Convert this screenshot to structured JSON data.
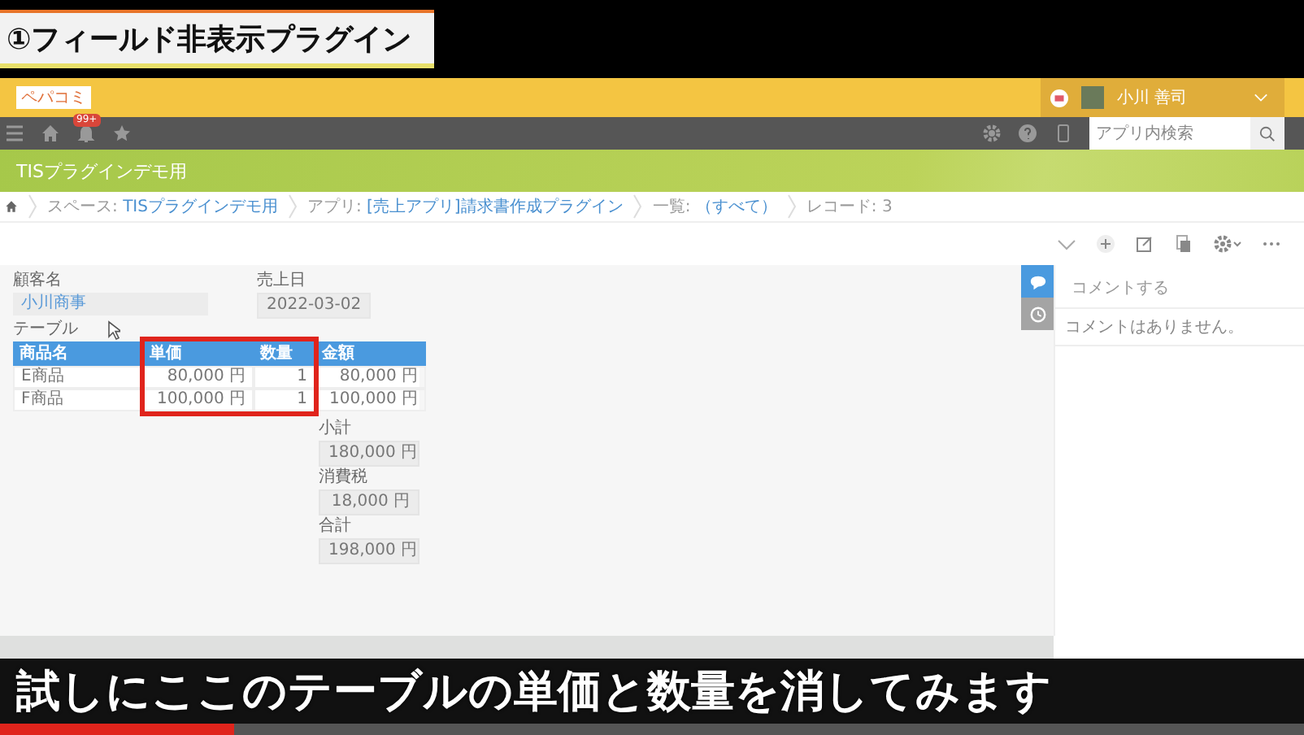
{
  "video_title": "①フィールド非表示プラグイン",
  "header": {
    "logo": "ペパコミ",
    "user_name": "小川 善司"
  },
  "nav": {
    "notification_badge": "99+",
    "search": {
      "placeholder": "アプリ内検索"
    }
  },
  "space_title": "TISプラグインデモ用",
  "breadcrumb": [
    {
      "label": "スペース: ",
      "link": "TISプラグインデモ用"
    },
    {
      "label": "アプリ: ",
      "link": "[売上アプリ]請求書作成プラグイン"
    },
    {
      "label": "一覧: ",
      "link": "（すべて）"
    },
    {
      "label": "レコード: 3"
    }
  ],
  "record": {
    "fields": [
      {
        "label": "顧客名",
        "value": "小川商事",
        "kind": "link"
      },
      {
        "label": "売上日",
        "value": "2022-03-02",
        "kind": "plain"
      }
    ],
    "table_label": "テーブル",
    "table": {
      "columns": [
        "商品名",
        "単価",
        "数量",
        "金額"
      ],
      "rows": [
        [
          "E商品",
          "80,000 円",
          "1",
          "80,000 円"
        ],
        [
          "F商品",
          "100,000 円",
          "1",
          "100,000 円"
        ]
      ]
    },
    "totals": [
      {
        "label": "小計",
        "value": "180,000 円"
      },
      {
        "label": "消費税",
        "value": "18,000 円"
      },
      {
        "label": "合計",
        "value": "198,000 円"
      }
    ]
  },
  "comments": {
    "tabs": [
      {
        "kind": "comment",
        "selected": true
      },
      {
        "kind": "history",
        "selected": false
      }
    ],
    "placeholder": "コメントする",
    "empty": "コメントはありません。"
  },
  "caption": "試しにここのテーブルの単価と数量を消してみます",
  "progress": {
    "level": 0.18
  }
}
